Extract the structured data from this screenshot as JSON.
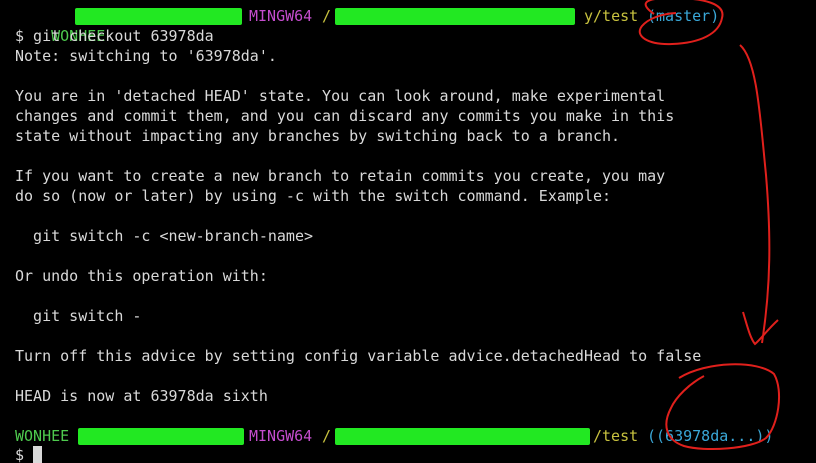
{
  "prompt": {
    "user": "WONHEE",
    "system": "MINGW64",
    "path_1": "/",
    "path_2_suffix": "y/test",
    "path_3_suffix": "/test",
    "branch_1": "(master)",
    "branch_2": "((63978da...))",
    "dollar": "$"
  },
  "command": "$ git checkout 63978da",
  "output": [
    "Note: switching to '63978da'.",
    "",
    "You are in 'detached HEAD' state. You can look around, make experimental",
    "changes and commit them, and you can discard any commits you make in this",
    "state without impacting any branches by switching back to a branch.",
    "",
    "If you want to create a new branch to retain commits you create, you may",
    "do so (now or later) by using -c with the switch command. Example:",
    "",
    "  git switch -c <new-branch-name>",
    "",
    "Or undo this operation with:",
    "",
    "  git switch -",
    "",
    "Turn off this advice by setting config variable advice.detachedHead to false",
    "",
    "HEAD is now at 63978da sixth"
  ],
  "colors": {
    "background": "#000000",
    "text": "#d9d9d9",
    "user": "#4eca4e",
    "system": "#c44ccd",
    "path": "#c8c23f",
    "branch": "#3aa8d8",
    "redaction": "#22e822",
    "annotation": "#e0201c"
  }
}
